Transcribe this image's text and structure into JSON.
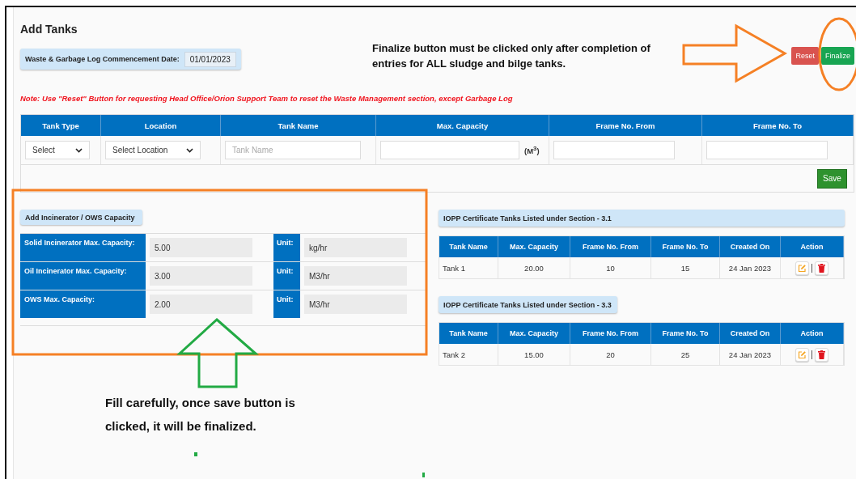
{
  "page": {
    "title": "Add Tanks"
  },
  "commencement": {
    "label": "Waste & Garbage Log Commencement Date:",
    "value": "01/01/2023"
  },
  "buttons": [
    {
      "label": "Reset",
      "kind": "reset"
    },
    {
      "label": "Finalize",
      "kind": "finalize"
    }
  ],
  "note": "Note: Use \"Reset\" Button for requesting Head Office/Orion Support Team to reset the Waste Management section, except Garbage Log",
  "add_form": {
    "columns": [
      "Tank Type",
      "Location",
      "Tank Name",
      "Max. Capacity",
      "Frame No. From",
      "Frame No. To"
    ],
    "fields": [
      {
        "kind": "select",
        "value": "Select"
      },
      {
        "kind": "select",
        "value": "Select Location"
      },
      {
        "kind": "text",
        "placeholder": "Tank Name"
      },
      {
        "kind": "text",
        "unit": "(M$^{3}$)"
      },
      {
        "kind": "text"
      },
      {
        "kind": "text"
      }
    ],
    "save_button": "Save"
  },
  "capacity": {
    "title": "Add Incinerator / OWS Capacity",
    "rows": [
      {
        "label": "Solid Incinerator Max. Capacity:",
        "value": "5.00",
        "unit_label": "Unit:",
        "unit": "kg/hr"
      },
      {
        "label": "Oil Incinerator Max. Capacity:",
        "value": "3.00",
        "unit_label": "Unit:",
        "unit": "M3/hr"
      },
      {
        "label": "OWS Max. Capacity:",
        "value": "2.00",
        "unit_label": "Unit:",
        "unit": "M3/hr"
      }
    ]
  },
  "sections": [
    {
      "title": "IOPP Certificate Tanks Listed under Section - 3.1",
      "wide": true,
      "columns": [
        "Tank Name",
        "Max. Capacity",
        "Frame No. From",
        "Frame No. To",
        "Created On",
        "Action"
      ],
      "rows": [
        {
          "cells": [
            "Tank 1",
            "20.00",
            "10",
            "15",
            "24 Jan 2023"
          ]
        }
      ]
    },
    {
      "title": "IOPP Certificate Tanks Listed under Section - 3.3",
      "wide": false,
      "columns": [
        "Tank Name",
        "Max. Capacity",
        "Frame No. From",
        "Frame No. To",
        "Created On",
        "Action"
      ],
      "rows": [
        {
          "cells": [
            "Tank 2",
            "15.00",
            "20",
            "25",
            "24 Jan 2023"
          ]
        }
      ]
    }
  ],
  "annotations": [
    {
      "kind": "finalize",
      "text": "Finalize button must be clicked only after completion of entries for ALL sludge and bilge tanks."
    },
    {
      "kind": "save",
      "text": "Fill carefully, once save button is clicked, it will be finalized."
    }
  ]
}
